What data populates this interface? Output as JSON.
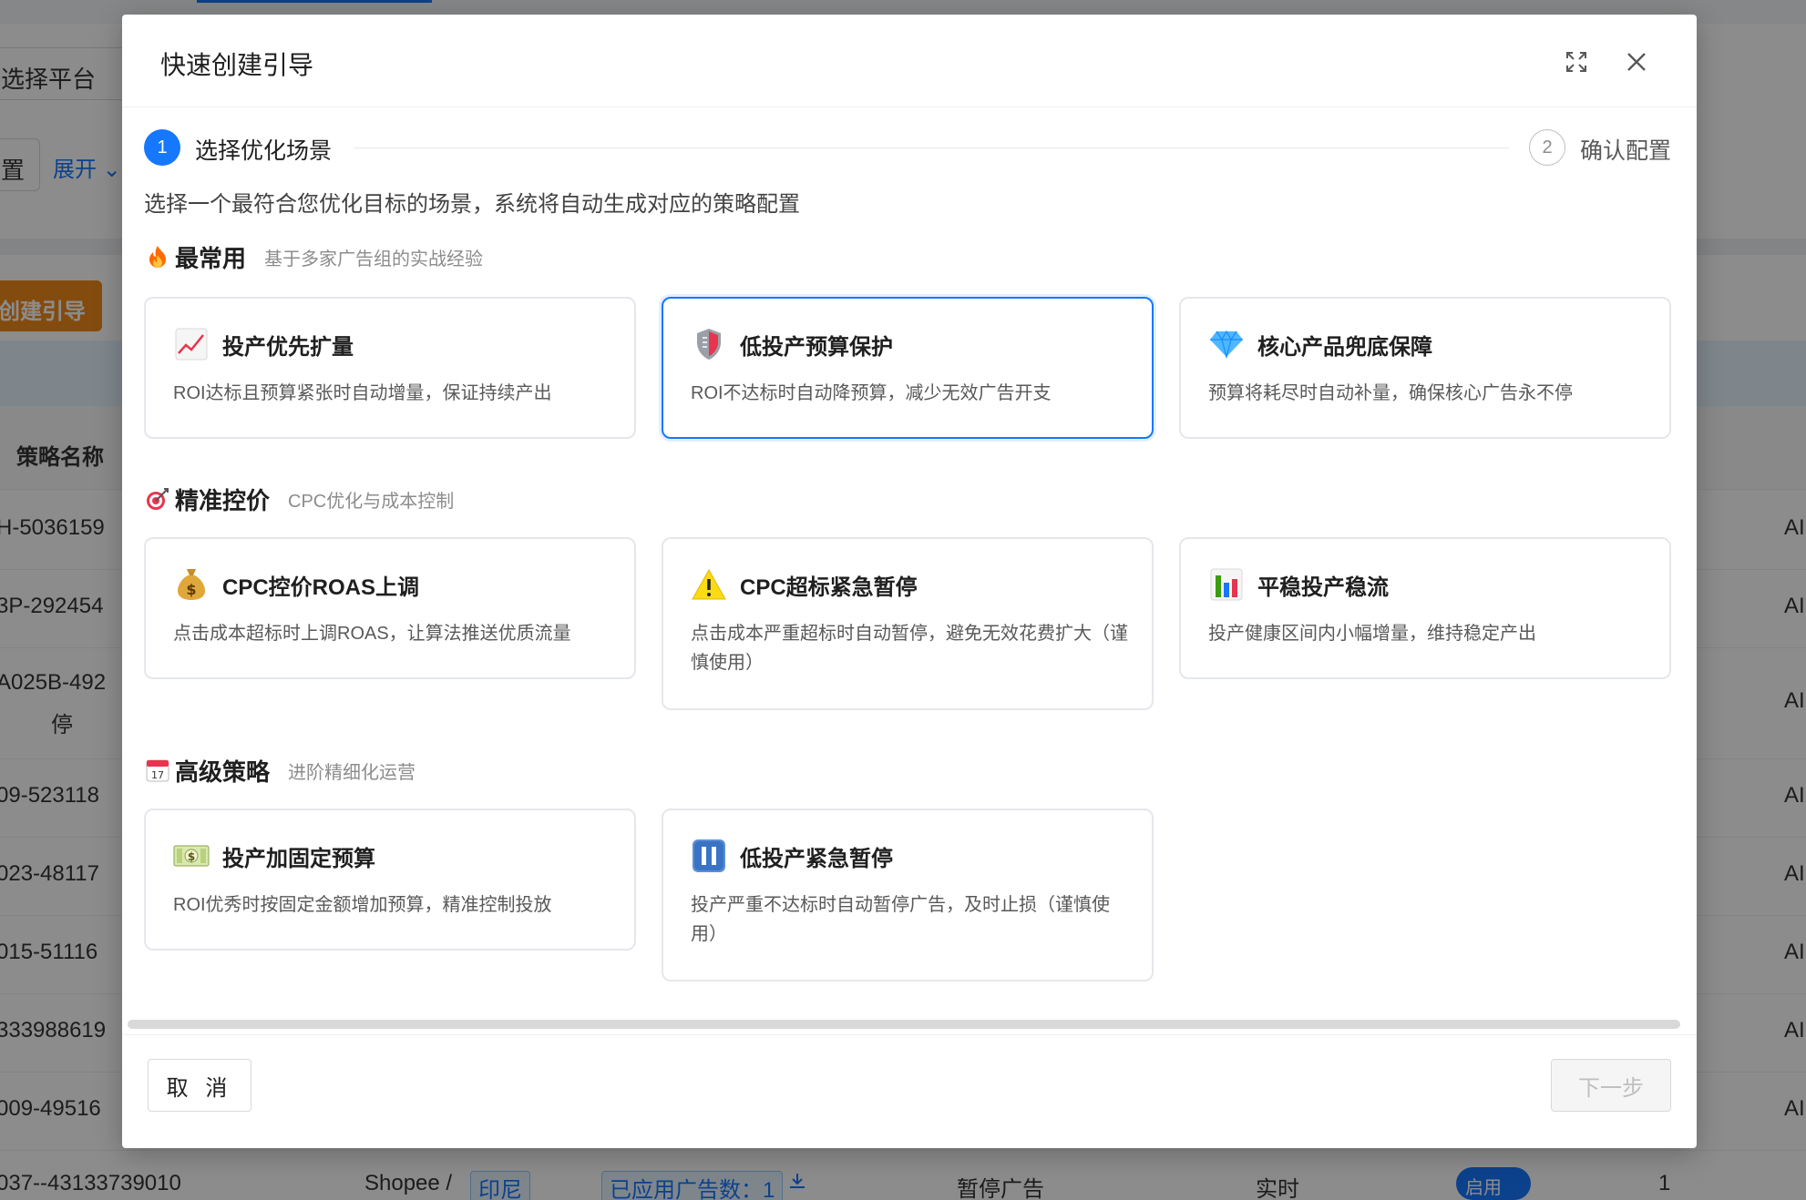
{
  "background": {
    "platform_select": "选择平台",
    "config_btn": "置",
    "expand": "展开",
    "create_btn": "创建引导",
    "col_strategy_name": "策略名称",
    "rows": [
      {
        "id": "H-5036159",
        "right": "AI"
      },
      {
        "id": "3P-292454",
        "right": "AI"
      },
      {
        "id": "A025B-492",
        "id2": "停",
        "right": "AI"
      },
      {
        "id": "09-523118",
        "right": "AI"
      },
      {
        "id": "023-48117",
        "right": "AI"
      },
      {
        "id": "015-51116",
        "right": "AI"
      },
      {
        "id": "333988619",
        "right": "AI"
      },
      {
        "id": "009-49516",
        "right": "AI"
      }
    ],
    "bottom_row": {
      "id": "037--43133739010",
      "platform": "Shopee /",
      "region": "印尼",
      "applied": "已应用广告数：1",
      "action": "暂停广告",
      "frequency": "实时",
      "switch": "启用",
      "count": "1"
    }
  },
  "modal": {
    "title": "快速创建引导",
    "steps": [
      {
        "num": "1",
        "label": "选择优化场景"
      },
      {
        "num": "2",
        "label": "确认配置"
      }
    ],
    "intro": "选择一个最符合您优化目标的场景，系统将自动生成对应的策略配置",
    "sections": [
      {
        "title": "最常用",
        "subtitle": "基于多家广告组的实战经验",
        "icon": "fire-icon",
        "cards": [
          {
            "title": "投产优先扩量",
            "desc": "ROI达标且预算紧张时自动增量，保证持续产出",
            "icon": "chart-up-icon"
          },
          {
            "title": "低投产预算保护",
            "desc": "ROI不达标时自动降预算，减少无效广告开支",
            "icon": "shield-icon"
          },
          {
            "title": "核心产品兜底保障",
            "desc": "预算将耗尽时自动补量，确保核心广告永不停",
            "icon": "diamond-icon"
          }
        ]
      },
      {
        "title": "精准控价",
        "subtitle": "CPC优化与成本控制",
        "icon": "target-icon",
        "cards": [
          {
            "title": "CPC控价ROAS上调",
            "desc": "点击成本超标时上调ROAS，让算法推送优质流量",
            "icon": "money-bag-icon"
          },
          {
            "title": "CPC超标紧急暂停",
            "desc": "点击成本严重超标时自动暂停，避免无效花费扩大（谨慎使用）",
            "icon": "warning-icon"
          },
          {
            "title": "平稳投产稳流",
            "desc": "投产健康区间内小幅增量，维持稳定产出",
            "icon": "bar-chart-icon"
          }
        ]
      },
      {
        "title": "高级策略",
        "subtitle": "进阶精细化运营",
        "icon": "calendar-icon",
        "calendar_day": "17",
        "cards": [
          {
            "title": "投产加固定预算",
            "desc": "ROI优秀时按固定金额增加预算，精准控制投放",
            "icon": "dollar-bill-icon"
          },
          {
            "title": "低投产紧急暂停",
            "desc": "投产严重不达标时自动暂停广告，及时止损（谨慎使用）",
            "icon": "pause-icon"
          }
        ]
      }
    ],
    "footer": {
      "cancel": "取 消",
      "next": "下一步"
    },
    "colors": {
      "primary": "#1677ff",
      "border": "#e5e7eb",
      "disabled_text": "#bfbfbf"
    }
  }
}
